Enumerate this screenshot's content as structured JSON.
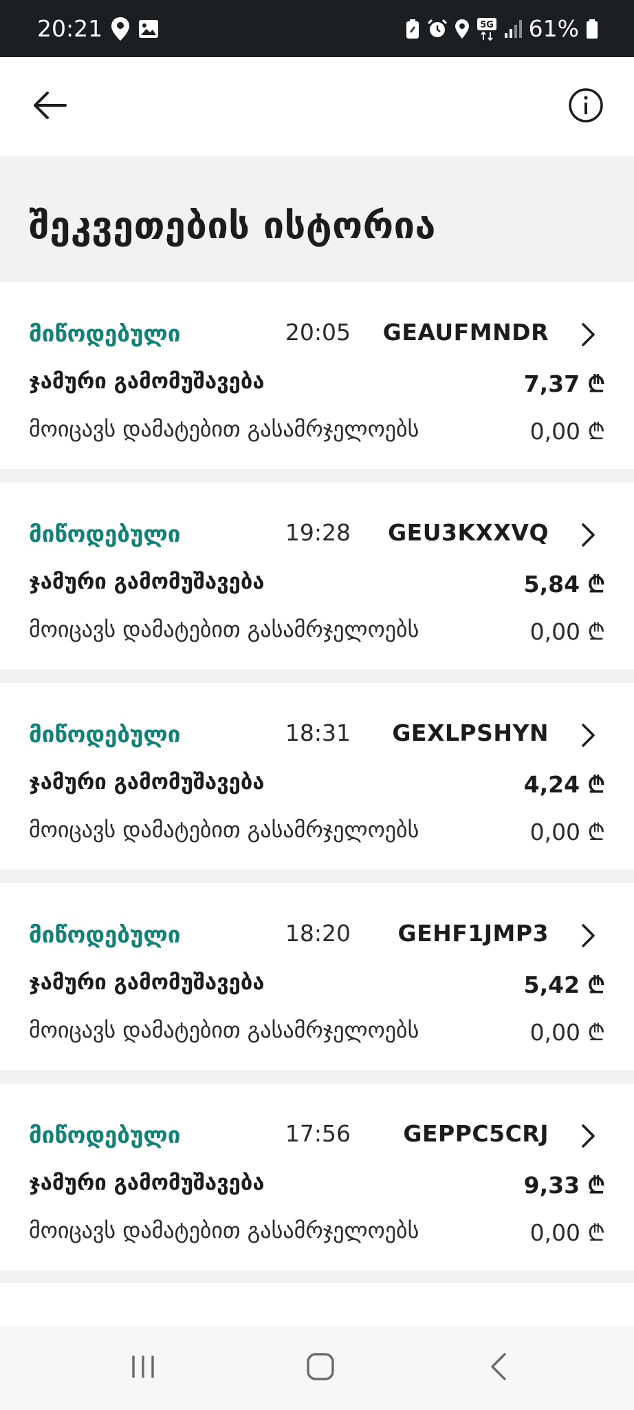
{
  "status_bar": {
    "time": "20:21",
    "battery_percent": "61%",
    "network": "5G",
    "left_icons": [
      "location-pin-icon",
      "image-icon"
    ],
    "right_icons": [
      "battery-saver-icon",
      "alarm-icon",
      "location-icon",
      "5g-icon",
      "signal-icon",
      "battery-icon"
    ]
  },
  "header": {
    "back_icon": "back-arrow-icon",
    "info_icon": "info-icon"
  },
  "page": {
    "title": "შეკვეთების ისტორია"
  },
  "orders": [
    {
      "status": "მიწოდებული",
      "time": "20:05",
      "id": "GEAUFMNDR",
      "total_label": "ჯამური გამომუშავება",
      "total_amount": "7,37 ₾",
      "tips_label": "მოიცავს დამატებით გასამრჯელოებს",
      "tips_amount": "0,00 ₾"
    },
    {
      "status": "მიწოდებული",
      "time": "19:28",
      "id": "GEU3KXXVQ",
      "total_label": "ჯამური გამომუშავება",
      "total_amount": "5,84 ₾",
      "tips_label": "მოიცავს დამატებით გასამრჯელოებს",
      "tips_amount": "0,00 ₾"
    },
    {
      "status": "მიწოდებული",
      "time": "18:31",
      "id": "GEXLPSHYN",
      "total_label": "ჯამური გამომუშავება",
      "total_amount": "4,24 ₾",
      "tips_label": "მოიცავს დამატებით გასამრჯელოებს",
      "tips_amount": "0,00 ₾"
    },
    {
      "status": "მიწოდებული",
      "time": "18:20",
      "id": "GEHF1JMP3",
      "total_label": "ჯამური გამომუშავება",
      "total_amount": "5,42 ₾",
      "tips_label": "მოიცავს დამატებით გასამრჯელოებს",
      "tips_amount": "0,00 ₾"
    },
    {
      "status": "მიწოდებული",
      "time": "17:56",
      "id": "GEPPC5CRJ",
      "total_label": "ჯამური გამომუშავება",
      "total_amount": "9,33 ₾",
      "tips_label": "მოიცავს დამატებით გასამრჯელოებს",
      "tips_amount": "0,00 ₾"
    }
  ],
  "nav_bar": {
    "icons": [
      "recent-apps-icon",
      "home-icon",
      "back-icon"
    ]
  },
  "colors": {
    "status_green": "#138276",
    "status_bar_bg": "#1b1f22",
    "text_dark": "#1c1c1c",
    "separator": "#f2f2f2"
  }
}
